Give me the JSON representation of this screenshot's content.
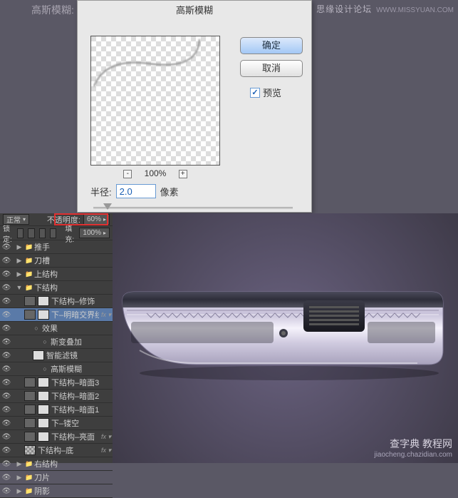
{
  "top_label": "高斯模糊:",
  "dialog": {
    "title": "高斯模糊",
    "ok": "确定",
    "cancel": "取消",
    "preview_label": "预览",
    "zoom": "100%",
    "radius_label": "半径:",
    "radius_value": "2.0",
    "radius_unit": "像素"
  },
  "watermark_top": {
    "main": "思缘设计论坛",
    "url": "WWW.MISSYUAN.COM"
  },
  "watermark_bottom": {
    "main": "查字典 教程网",
    "url": "jiaocheng.chazidian.com"
  },
  "panel": {
    "blend": "正常",
    "opacity_label": "不透明度:",
    "opacity_value": "60%",
    "lock_label": "锁定:",
    "fill_label": "填充:",
    "fill_value": "100%"
  },
  "layers": [
    {
      "t": "group",
      "name": "推手",
      "fold": "▶",
      "ind": 1
    },
    {
      "t": "group",
      "name": "刀槽",
      "fold": "▶",
      "ind": 1
    },
    {
      "t": "group",
      "name": "上结构",
      "fold": "▶",
      "ind": 1
    },
    {
      "t": "group",
      "name": "下结构",
      "fold": "▼",
      "ind": 1
    },
    {
      "t": "layer",
      "name": "下结构–修饰",
      "ind": 2,
      "mask": 1
    },
    {
      "t": "layer",
      "name": "下–明暗交界线",
      "ind": 2,
      "mask": 1,
      "sel": 1,
      "fx": 1
    },
    {
      "t": "sub",
      "name": "效果",
      "ind": 3
    },
    {
      "t": "sub",
      "name": "斯变叠加",
      "ind": 4,
      "eye": 1
    },
    {
      "t": "sub",
      "name": "智能滤镜",
      "ind": 3,
      "eye": 1,
      "thumb": 1
    },
    {
      "t": "sub",
      "name": "高斯模糊",
      "ind": 4
    },
    {
      "t": "layer",
      "name": "下结构–暗面3",
      "ind": 2,
      "mask": 1
    },
    {
      "t": "layer",
      "name": "下结构–暗面2",
      "ind": 2,
      "mask": 1
    },
    {
      "t": "layer",
      "name": "下结构–暗面1",
      "ind": 2,
      "mask": 1
    },
    {
      "t": "layer",
      "name": "下–镂空",
      "ind": 2,
      "mask": 1
    },
    {
      "t": "layer",
      "name": "下结构–亮面",
      "ind": 2,
      "mask": 1,
      "fx": 1
    },
    {
      "t": "layer",
      "name": "下结构–底",
      "ind": 2,
      "chk": 1,
      "fx": 1
    },
    {
      "t": "group",
      "name": "右结构",
      "fold": "▶",
      "ind": 1
    },
    {
      "t": "group",
      "name": "刀片",
      "fold": "▶",
      "ind": 1
    },
    {
      "t": "group",
      "name": "阴影",
      "fold": "▶",
      "ind": 1
    }
  ]
}
